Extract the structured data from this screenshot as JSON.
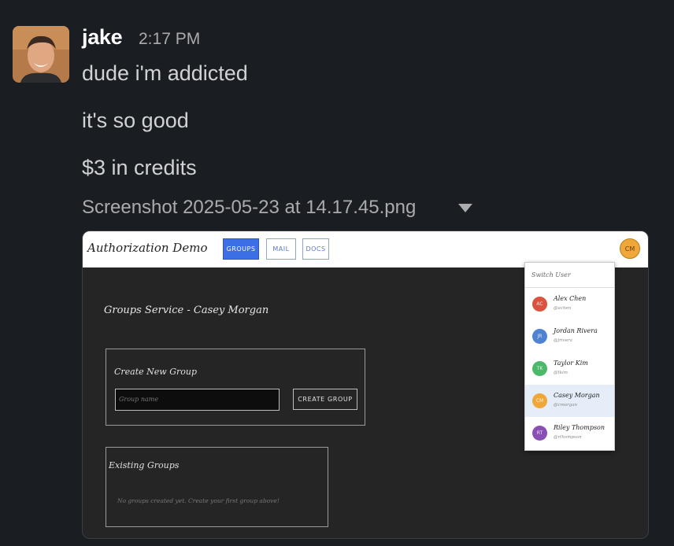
{
  "message": {
    "author": "jake",
    "time": "2:17 PM",
    "lines": [
      "dude i'm addicted",
      "it's so good",
      "$3 in credits"
    ],
    "attachment_name": "Screenshot 2025-05-23 at 14.17.45.png"
  },
  "screenshot": {
    "app_title": "Authorization Demo",
    "tabs": [
      {
        "label": "GROUPS",
        "active": true
      },
      {
        "label": "MAIL",
        "active": false
      },
      {
        "label": "DOCS",
        "active": false
      }
    ],
    "current_user_initials": "CM",
    "service_title": "Groups Service - Casey Morgan",
    "create_panel": {
      "title": "Create New Group",
      "input_placeholder": "Group name",
      "button_label": "CREATE GROUP"
    },
    "existing_panel": {
      "title": "Existing Groups",
      "empty_message": "No groups created yet. Create your first group above!"
    },
    "switch_user": {
      "heading": "Switch User",
      "users": [
        {
          "initials": "AC",
          "name": "Alex Chen",
          "handle": "@achen",
          "color": "#d9533f",
          "selected": false
        },
        {
          "initials": "JR",
          "name": "Jordan Rivera",
          "handle": "@jrivera",
          "color": "#4f83d1",
          "selected": false
        },
        {
          "initials": "TK",
          "name": "Taylor Kim",
          "handle": "@tkim",
          "color": "#4cb86a",
          "selected": false
        },
        {
          "initials": "CM",
          "name": "Casey Morgan",
          "handle": "@cmorgan",
          "color": "#f0a73a",
          "selected": true
        },
        {
          "initials": "RT",
          "name": "Riley Thompson",
          "handle": "@rthompson",
          "color": "#8a4fb3",
          "selected": false
        }
      ]
    }
  },
  "colors": {
    "background": "#1a1d21",
    "accent": "#3c6ee6"
  }
}
